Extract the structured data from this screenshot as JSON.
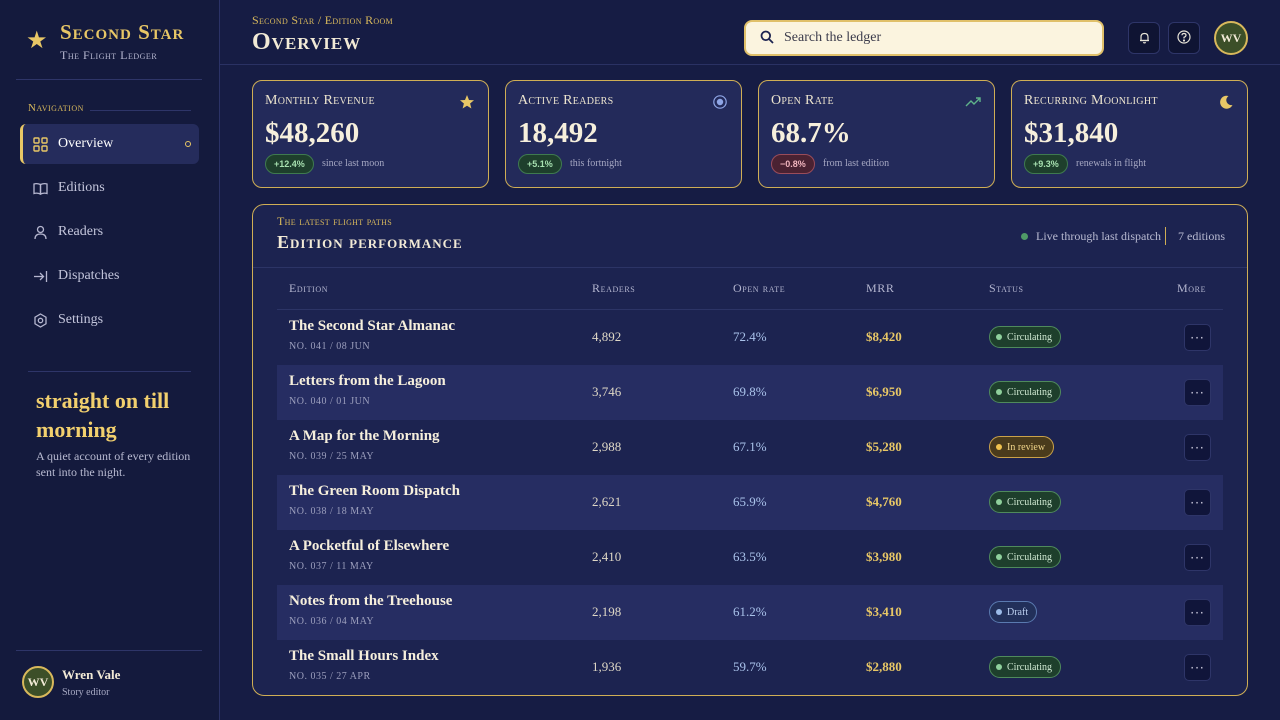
{
  "brand": {
    "title": "Second Star",
    "subtitle": "The Flight Ledger"
  },
  "nav": {
    "heading": "Navigation",
    "items": [
      {
        "label": "Overview",
        "icon": "grid-icon",
        "active": true
      },
      {
        "label": "Editions",
        "icon": "book-icon"
      },
      {
        "label": "Readers",
        "icon": "person-icon"
      },
      {
        "label": "Dispatches",
        "icon": "send-icon"
      },
      {
        "label": "Settings",
        "icon": "gear-icon"
      }
    ]
  },
  "tagline": {
    "title": "straight on till morning",
    "description": "A quiet account of every edition sent into the night."
  },
  "user": {
    "initials": "WV",
    "name": "Wren Vale",
    "role": "Story editor"
  },
  "header": {
    "breadcrumb": "Second Star / Edition Room",
    "title": "Overview",
    "search_placeholder": "Search the ledger",
    "avatar_initials": "WV"
  },
  "kpis": [
    {
      "label": "Monthly Revenue",
      "value": "$48,260",
      "change": "+12.4%",
      "direction": "up",
      "note": "since last moon",
      "icon": "star-icon"
    },
    {
      "label": "Active Readers",
      "value": "18,492",
      "change": "+5.1%",
      "direction": "up",
      "note": "this fortnight",
      "icon": "target-icon"
    },
    {
      "label": "Open Rate",
      "value": "68.7%",
      "change": "−0.8%",
      "direction": "down",
      "note": "from last edition",
      "icon": "trend-up-icon"
    },
    {
      "label": "Recurring Moonlight",
      "value": "$31,840",
      "change": "+9.3%",
      "direction": "up",
      "note": "renewals in flight",
      "icon": "moon-icon"
    }
  ],
  "panel": {
    "eyebrow": "The latest flight paths",
    "title": "Edition performance",
    "live_text": "Live through last dispatch",
    "count_text": "7 editions",
    "columns": {
      "edition": "Edition",
      "readers": "Readers",
      "open_rate": "Open rate",
      "mrr": "MRR",
      "status": "Status",
      "more": "More"
    }
  },
  "editions": [
    {
      "name": "The Second Star Almanac",
      "meta": "NO. 041 / 08 JUN",
      "readers": "4,892",
      "open_rate": "72.4%",
      "mrr": "$8,420",
      "status": "Circulating",
      "status_type": "circ"
    },
    {
      "name": "Letters from the Lagoon",
      "meta": "NO. 040 / 01 JUN",
      "readers": "3,746",
      "open_rate": "69.8%",
      "mrr": "$6,950",
      "status": "Circulating",
      "status_type": "circ"
    },
    {
      "name": "A Map for the Morning",
      "meta": "NO. 039 / 25 MAY",
      "readers": "2,988",
      "open_rate": "67.1%",
      "mrr": "$5,280",
      "status": "In review",
      "status_type": "review"
    },
    {
      "name": "The Green Room Dispatch",
      "meta": "NO. 038 / 18 MAY",
      "readers": "2,621",
      "open_rate": "65.9%",
      "mrr": "$4,760",
      "status": "Circulating",
      "status_type": "circ"
    },
    {
      "name": "A Pocketful of Elsewhere",
      "meta": "NO. 037 / 11 MAY",
      "readers": "2,410",
      "open_rate": "63.5%",
      "mrr": "$3,980",
      "status": "Circulating",
      "status_type": "circ"
    },
    {
      "name": "Notes from the Treehouse",
      "meta": "NO. 036 / 04 MAY",
      "readers": "2,198",
      "open_rate": "61.2%",
      "mrr": "$3,410",
      "status": "Draft",
      "status_type": "draft"
    },
    {
      "name": "The Small Hours Index",
      "meta": "NO. 035 / 27 APR",
      "readers": "1,936",
      "open_rate": "59.7%",
      "mrr": "$2,880",
      "status": "Circulating",
      "status_type": "circ"
    }
  ],
  "colors": {
    "accent": "#e8c766",
    "background": "#161c44",
    "sidebar": "#141a3d",
    "card": "#232a5a",
    "positive": "#4f9a67",
    "negative": "#9a4c5a"
  }
}
